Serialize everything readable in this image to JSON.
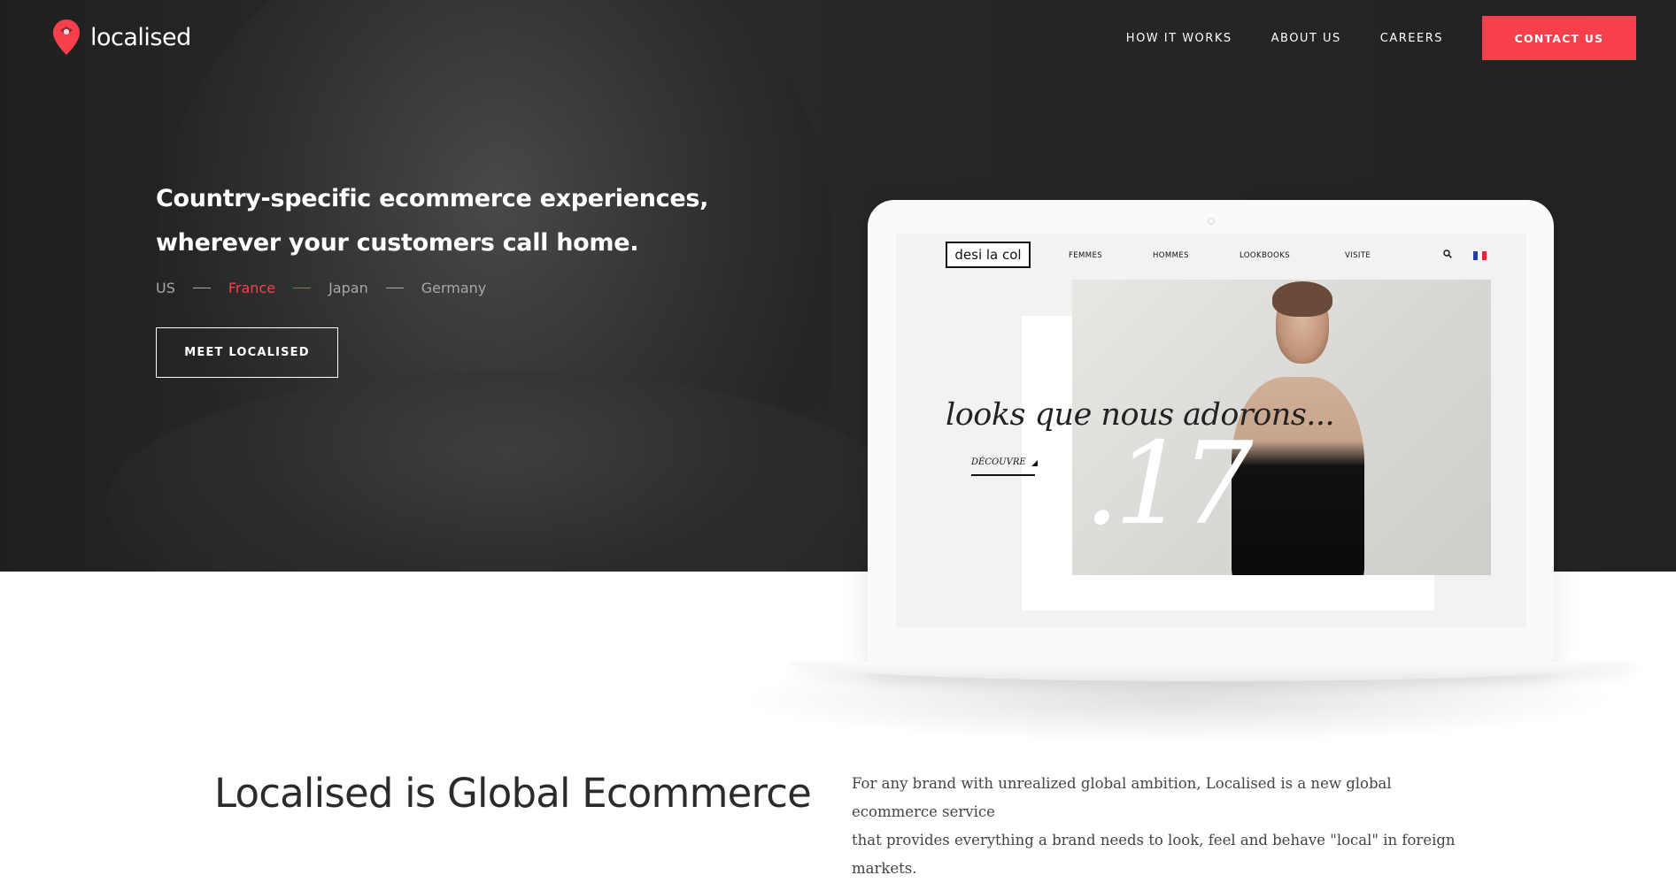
{
  "brand": {
    "name": "localised",
    "accent": "#f7404b"
  },
  "nav": {
    "items": [
      "HOW IT WORKS",
      "ABOUT US",
      "CAREERS"
    ],
    "contact_label": "CONTACT US"
  },
  "hero": {
    "headline_line1": "Country-specific ecommerce experiences,",
    "headline_line2": "wherever your customers call home.",
    "countries": [
      "US",
      "France",
      "Japan",
      "Germany"
    ],
    "active_country": "France",
    "cta_label": "MEET LOCALISED"
  },
  "laptop_site": {
    "logo": "desi la col",
    "nav": [
      "FEMMES",
      "HOMMES",
      "LOOKBOOKS",
      "VISITE"
    ],
    "search_icon": "search-icon",
    "flag": "france-flag-icon",
    "slogan": "looks que nous adorons...",
    "cta": "DÉCOUVRE",
    "big_number": ".17"
  },
  "intro": {
    "title": "Localised is Global Ecommerce",
    "body_line1": "For any brand with unrealized global ambition, Localised is a new global ecommerce service",
    "body_line2": "that provides everything a brand needs to look, feel and behave \"local\" in foreign markets."
  }
}
